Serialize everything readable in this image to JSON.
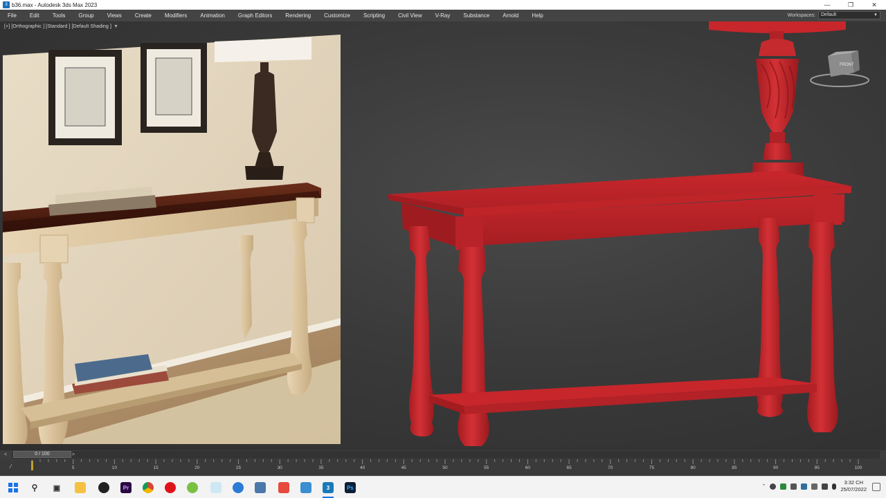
{
  "window": {
    "title": "b36.max - Autodesk 3ds Max 2023",
    "app_icon": "3ds-max-icon"
  },
  "menu": [
    "File",
    "Edit",
    "Tools",
    "Group",
    "Views",
    "Create",
    "Modifiers",
    "Animation",
    "Graph Editors",
    "Rendering",
    "Customize",
    "Scripting",
    "Civil View",
    "V-Ray",
    "Substance",
    "Arnold",
    "Help"
  ],
  "workspaces": {
    "label": "Workspaces:",
    "value": "Default"
  },
  "viewport": {
    "label": "[+] [Orthographic ] [Standard ] [Default Shading ]",
    "viewcube_face": "FRONT"
  },
  "timeline": {
    "frame": "0 / 100",
    "prev": "<",
    "next": ">"
  },
  "trackbar": {
    "labels": [
      "5",
      "10",
      "15",
      "20",
      "25",
      "30",
      "35",
      "40",
      "45",
      "50",
      "55",
      "60",
      "65",
      "70",
      "75",
      "80",
      "85",
      "90",
      "95",
      "100"
    ],
    "ticks_max": 100
  },
  "taskbar": {
    "apps": [
      "windows-start-icon",
      "search-icon",
      "task-view-icon",
      "file-explorer-icon",
      "obs-icon",
      "premiere-icon",
      "chrome-icon",
      "opera-icon",
      "greenshot-icon",
      "notepad-icon",
      "edge-icon",
      "calculator-icon",
      "anydesk-icon",
      "photos-icon",
      "3dsmax-icon",
      "photoshop-icon"
    ],
    "premiere_label": "Pr",
    "max_label": "3",
    "photoshop_label": "Ps",
    "time": "3:32 CH",
    "date": "25/07/2022"
  },
  "colors": {
    "model_red": "#c8262b",
    "menubar": "#444444",
    "viewport_bg": "#3a3a3a"
  }
}
